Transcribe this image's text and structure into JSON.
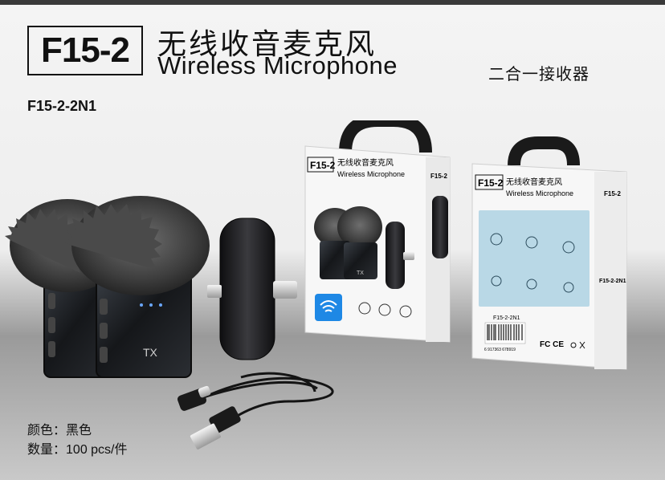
{
  "header": {
    "model_badge": "F15-2",
    "title_cn": "无线收音麦克风",
    "title_en": "Wireless Microphone",
    "subtitle_cn": "二合一接收器"
  },
  "model_code": "F15-2-2N1",
  "specs": [
    {
      "label": "颜色：",
      "value": "黑色"
    },
    {
      "label": "数量：",
      "value": "100 pcs/件"
    }
  ],
  "transmitter_label": "TX",
  "box_front": {
    "badge": "F15-2",
    "title_cn": "无线收音麦克风",
    "title_en": "Wireless Microphone",
    "side_badge": "F15-2",
    "small_tx": "TX"
  },
  "box_back": {
    "badge": "F15-2",
    "title_cn": "无线收音麦克风",
    "title_en": "Wireless Microphone",
    "side_badge": "F15-2",
    "side_code": "F15-2-2N1",
    "barcode_code": "F15-2-2N1",
    "marks": "FC CE",
    "barcode_digits": "6 917363 678919"
  },
  "colors": {
    "accent_blue": "#1e88e5",
    "panel_blue": "#b9d8e6",
    "device_black": "#1c1c1e"
  }
}
